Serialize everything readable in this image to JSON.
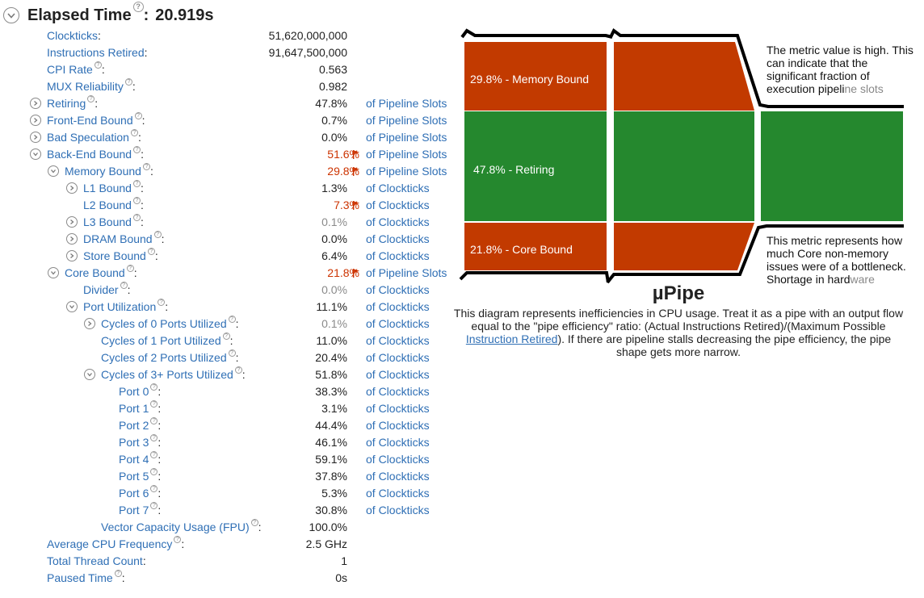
{
  "header": {
    "title": "Elapsed Time",
    "value": "20.919s"
  },
  "metrics": [
    {
      "id": "clockticks",
      "label": "Clockticks",
      "value": "51,620,000,000",
      "unit": "",
      "level": 0,
      "toggle": "",
      "help": false,
      "color": "normal",
      "flag": false
    },
    {
      "id": "instructions-retired",
      "label": "Instructions Retired",
      "value": "91,647,500,000",
      "unit": "",
      "level": 0,
      "toggle": "",
      "help": false,
      "color": "normal",
      "flag": false
    },
    {
      "id": "cpi-rate",
      "label": "CPI Rate",
      "value": "0.563",
      "unit": "",
      "level": 0,
      "toggle": "",
      "help": true,
      "color": "normal",
      "flag": false
    },
    {
      "id": "mux-reliability",
      "label": "MUX Reliability",
      "value": "0.982",
      "unit": "",
      "level": 0,
      "toggle": "",
      "help": true,
      "color": "normal",
      "flag": false
    },
    {
      "id": "retiring",
      "label": "Retiring",
      "value": "47.8%",
      "unit": "of Pipeline Slots",
      "level": 0,
      "toggle": "collapsed",
      "help": true,
      "color": "normal",
      "flag": false
    },
    {
      "id": "front-end-bound",
      "label": "Front-End Bound",
      "value": "0.7%",
      "unit": "of Pipeline Slots",
      "level": 0,
      "toggle": "collapsed",
      "help": true,
      "color": "normal",
      "flag": false
    },
    {
      "id": "bad-speculation",
      "label": "Bad Speculation",
      "value": "0.0%",
      "unit": "of Pipeline Slots",
      "level": 0,
      "toggle": "collapsed",
      "help": true,
      "color": "normal",
      "flag": false
    },
    {
      "id": "back-end-bound",
      "label": "Back-End Bound",
      "value": "51.6%",
      "unit": "of Pipeline Slots",
      "level": 0,
      "toggle": "expanded",
      "help": true,
      "color": "red",
      "flag": true
    },
    {
      "id": "memory-bound",
      "label": "Memory Bound",
      "value": "29.8%",
      "unit": "of Pipeline Slots",
      "level": 1,
      "toggle": "expanded",
      "help": true,
      "color": "red",
      "flag": true
    },
    {
      "id": "l1-bound",
      "label": "L1 Bound",
      "value": "1.3%",
      "unit": "of Clockticks",
      "level": 2,
      "toggle": "collapsed",
      "help": true,
      "color": "normal",
      "flag": false
    },
    {
      "id": "l2-bound",
      "label": "L2 Bound",
      "value": "7.3%",
      "unit": "of Clockticks",
      "level": 2,
      "toggle": "",
      "help": true,
      "color": "red",
      "flag": true
    },
    {
      "id": "l3-bound",
      "label": "L3 Bound",
      "value": "0.1%",
      "unit": "of Clockticks",
      "level": 2,
      "toggle": "collapsed",
      "help": true,
      "color": "gray",
      "flag": false
    },
    {
      "id": "dram-bound",
      "label": "DRAM Bound",
      "value": "0.0%",
      "unit": "of Clockticks",
      "level": 2,
      "toggle": "collapsed",
      "help": true,
      "color": "normal",
      "flag": false
    },
    {
      "id": "store-bound",
      "label": "Store Bound",
      "value": "6.4%",
      "unit": "of Clockticks",
      "level": 2,
      "toggle": "collapsed",
      "help": true,
      "color": "normal",
      "flag": false
    },
    {
      "id": "core-bound",
      "label": "Core Bound",
      "value": "21.8%",
      "unit": "of Pipeline Slots",
      "level": 1,
      "toggle": "expanded",
      "help": true,
      "color": "red",
      "flag": true
    },
    {
      "id": "divider",
      "label": "Divider",
      "value": "0.0%",
      "unit": "of Clockticks",
      "level": 2,
      "toggle": "",
      "help": true,
      "color": "gray",
      "flag": false
    },
    {
      "id": "port-utilization",
      "label": "Port Utilization",
      "value": "11.1%",
      "unit": "of Clockticks",
      "level": 2,
      "toggle": "expanded",
      "help": true,
      "color": "normal",
      "flag": false
    },
    {
      "id": "cycles-0-ports",
      "label": "Cycles of 0 Ports Utilized",
      "value": "0.1%",
      "unit": "of Clockticks",
      "level": 3,
      "toggle": "collapsed",
      "help": true,
      "color": "gray",
      "flag": false
    },
    {
      "id": "cycles-1-port",
      "label": "Cycles of 1 Port Utilized",
      "value": "11.0%",
      "unit": "of Clockticks",
      "level": 3,
      "toggle": "",
      "help": true,
      "color": "normal",
      "flag": false
    },
    {
      "id": "cycles-2-ports",
      "label": "Cycles of 2 Ports Utilized",
      "value": "20.4%",
      "unit": "of Clockticks",
      "level": 3,
      "toggle": "",
      "help": true,
      "color": "normal",
      "flag": false
    },
    {
      "id": "cycles-3plus-ports",
      "label": "Cycles of 3+ Ports Utilized",
      "value": "51.8%",
      "unit": "of Clockticks",
      "level": 3,
      "toggle": "expanded",
      "help": true,
      "color": "normal",
      "flag": false
    },
    {
      "id": "port-0",
      "label": "Port 0",
      "value": "38.3%",
      "unit": "of Clockticks",
      "level": 4,
      "toggle": "",
      "help": true,
      "color": "normal",
      "flag": false
    },
    {
      "id": "port-1",
      "label": "Port 1",
      "value": "3.1%",
      "unit": "of Clockticks",
      "level": 4,
      "toggle": "",
      "help": true,
      "color": "normal",
      "flag": false
    },
    {
      "id": "port-2",
      "label": "Port 2",
      "value": "44.4%",
      "unit": "of Clockticks",
      "level": 4,
      "toggle": "",
      "help": true,
      "color": "normal",
      "flag": false
    },
    {
      "id": "port-3",
      "label": "Port 3",
      "value": "46.1%",
      "unit": "of Clockticks",
      "level": 4,
      "toggle": "",
      "help": true,
      "color": "normal",
      "flag": false
    },
    {
      "id": "port-4",
      "label": "Port 4",
      "value": "59.1%",
      "unit": "of Clockticks",
      "level": 4,
      "toggle": "",
      "help": true,
      "color": "normal",
      "flag": false
    },
    {
      "id": "port-5",
      "label": "Port 5",
      "value": "37.8%",
      "unit": "of Clockticks",
      "level": 4,
      "toggle": "",
      "help": true,
      "color": "normal",
      "flag": false
    },
    {
      "id": "port-6",
      "label": "Port 6",
      "value": "5.3%",
      "unit": "of Clockticks",
      "level": 4,
      "toggle": "",
      "help": true,
      "color": "normal",
      "flag": false
    },
    {
      "id": "port-7",
      "label": "Port 7",
      "value": "30.8%",
      "unit": "of Clockticks",
      "level": 4,
      "toggle": "",
      "help": true,
      "color": "normal",
      "flag": false
    },
    {
      "id": "vector-capacity-usage",
      "label": "Vector Capacity Usage (FPU)",
      "value": "100.0%",
      "unit": "",
      "level": 3,
      "toggle": "",
      "help": true,
      "color": "normal",
      "flag": false
    },
    {
      "id": "average-cpu-frequency",
      "label": "Average CPU Frequency",
      "value": "2.5 GHz",
      "unit": "",
      "level": 0,
      "toggle": "",
      "help": true,
      "color": "normal",
      "flag": false
    },
    {
      "id": "total-thread-count",
      "label": "Total Thread Count",
      "value": "1",
      "unit": "",
      "level": 0,
      "toggle": "",
      "help": false,
      "color": "normal",
      "flag": false
    },
    {
      "id": "paused-time",
      "label": "Paused Time",
      "value": "0s",
      "unit": "",
      "level": 0,
      "toggle": "",
      "help": true,
      "color": "normal",
      "flag": false
    }
  ],
  "pipe": {
    "memory_label": "29.8% - Memory Bound",
    "retiring_label": "47.8% - Retiring",
    "core_label": "21.8% - Core Bound",
    "top_note": {
      "main": "The metric value is high. This can indicate that the significant fraction of execution pipeli",
      "fade": "ne slots"
    },
    "bottom_note": {
      "main": "This metric represents how much Core non-memory issues were of a bottleneck. Shortage in hard",
      "fade": "ware"
    },
    "title": "µPipe",
    "desc_before": "This diagram represents inefficiencies in CPU usage. Treat it as a pipe with an output flow equal to the \"pipe efficiency\" ratio: (Actual Instructions Retired)/(Maximum Possible ",
    "desc_link": "Instruction Retired",
    "desc_after": "). If there are pipeline stalls decreasing the pipe efficiency, the pipe shape gets more narrow."
  },
  "colors": {
    "link": "#2f6fb5",
    "alert": "#cc3300",
    "muted": "#8a8a8a",
    "memory_bound": "#c23a00",
    "retiring": "#25882e",
    "core_bound": "#c23a00"
  },
  "icons": {
    "toggle": "chevron-icon",
    "help": "help-icon",
    "flag": "flag-icon"
  }
}
